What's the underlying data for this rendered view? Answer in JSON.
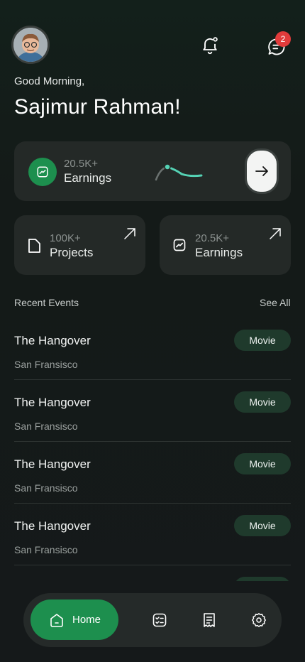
{
  "header": {
    "greeting": "Good Morning,",
    "user_name": "Sajimur Rahman!",
    "message_badge_count": "2"
  },
  "summary_card": {
    "value": "20.5K+",
    "label": "Earnings",
    "icon": "trend-up-icon"
  },
  "stat_cards": [
    {
      "value": "100K+",
      "label": "Projects",
      "icon": "file-icon"
    },
    {
      "value": "20.5K+",
      "label": "Earnings",
      "icon": "trend-up-icon"
    }
  ],
  "recent_events": {
    "title": "Recent Events",
    "see_all_label": "See All",
    "items": [
      {
        "title": "The Hangover",
        "location": "San Fransisco",
        "tag": "Movie"
      },
      {
        "title": "The Hangover",
        "location": "San Fransisco",
        "tag": "Movie"
      },
      {
        "title": "The Hangover",
        "location": "San Fransisco",
        "tag": "Movie"
      },
      {
        "title": "The Hangover",
        "location": "San Fransisco",
        "tag": "Movie"
      },
      {
        "title": "",
        "location": "",
        "tag": ""
      }
    ]
  },
  "bottom_nav": {
    "home_label": "Home",
    "items": [
      "home-icon",
      "tasks-icon",
      "receipt-icon",
      "settings-icon"
    ]
  },
  "colors": {
    "accent_green": "#1d8f4e",
    "card_bg": "#242927",
    "badge_red": "#e23b3b",
    "tag_bg": "#1f3a2c"
  }
}
